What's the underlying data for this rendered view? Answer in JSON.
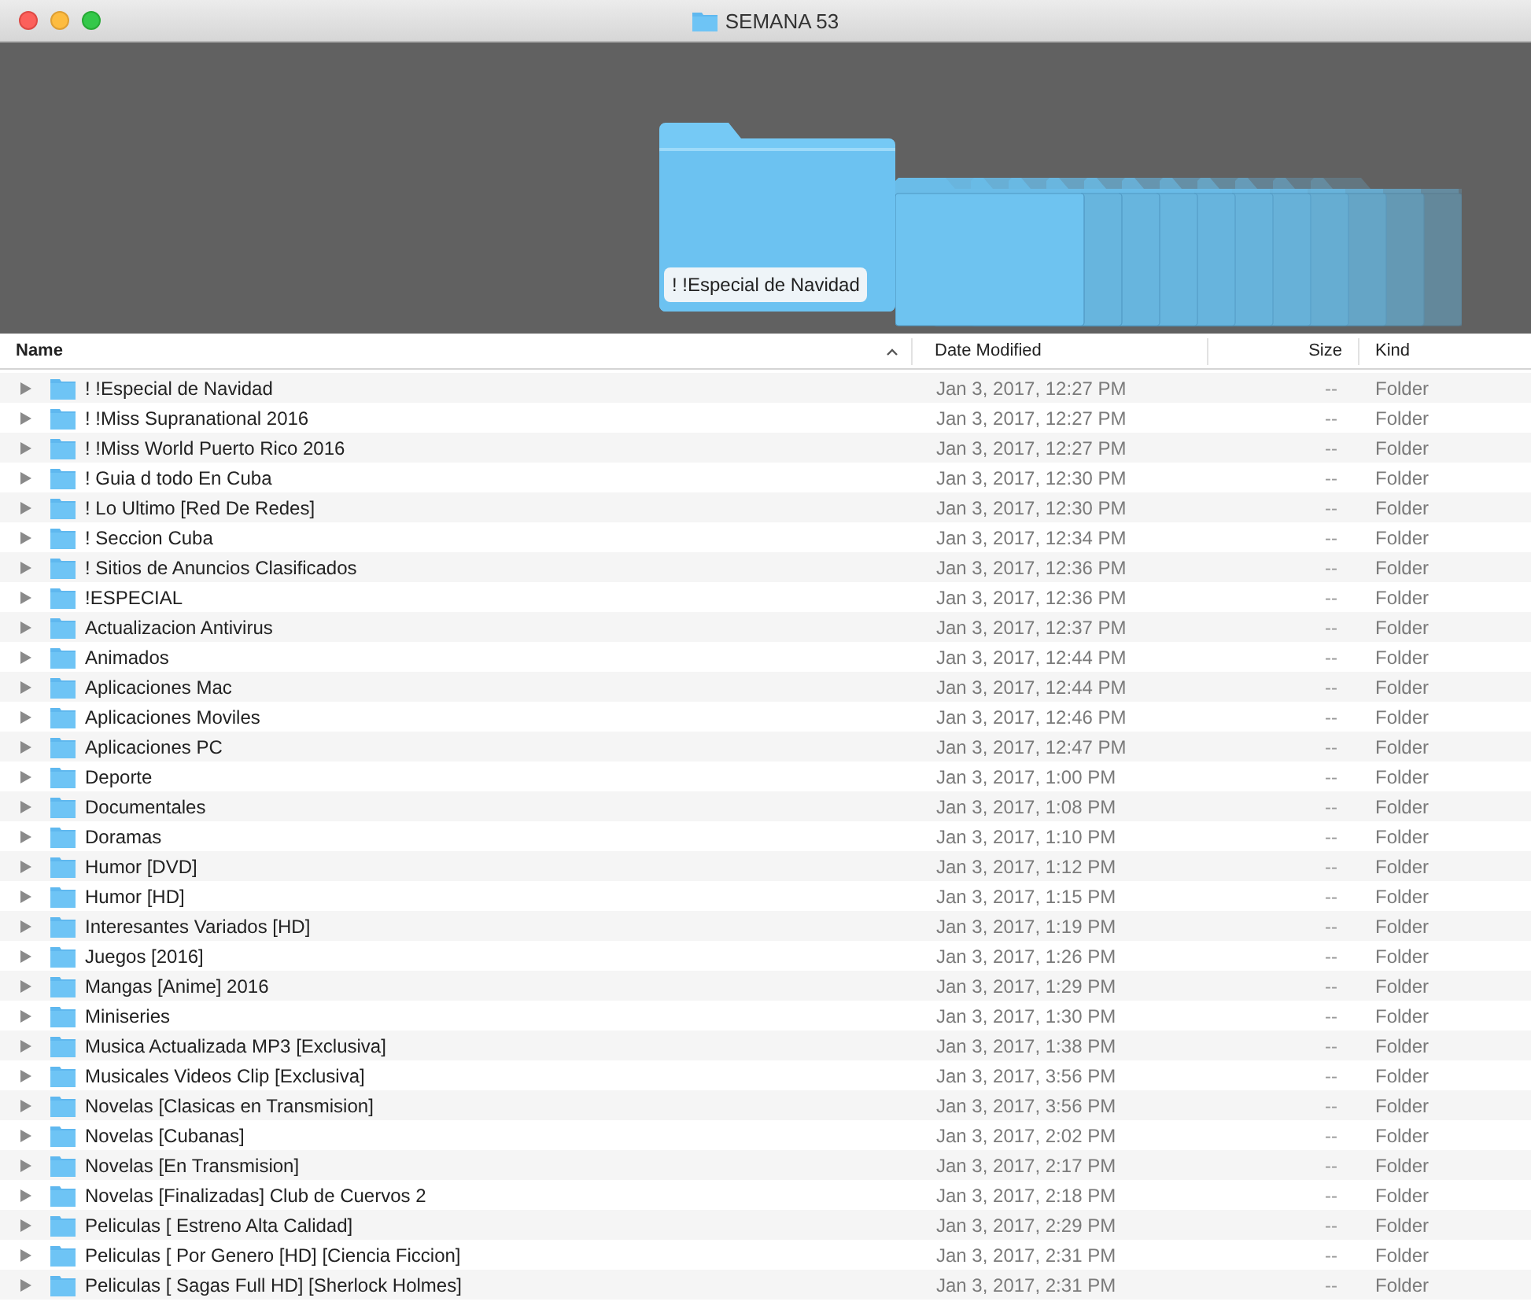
{
  "window": {
    "title": "SEMANA 53"
  },
  "preview": {
    "label": "! !Especial de Navidad"
  },
  "columns": [
    {
      "label": "Name",
      "sorted": true
    },
    {
      "label": "Date Modified",
      "sorted": false
    },
    {
      "label": "Size",
      "sorted": false
    },
    {
      "label": "Kind",
      "sorted": false
    }
  ],
  "rows": [
    {
      "name": "! !Especial de Navidad",
      "date": "Jan 3, 2017, 12:27 PM",
      "size": "--",
      "kind": "Folder"
    },
    {
      "name": "! !Miss Supranational 2016",
      "date": "Jan 3, 2017, 12:27 PM",
      "size": "--",
      "kind": "Folder"
    },
    {
      "name": "! !Miss World Puerto Rico 2016",
      "date": "Jan 3, 2017, 12:27 PM",
      "size": "--",
      "kind": "Folder"
    },
    {
      "name": "! Guia d todo En Cuba",
      "date": "Jan 3, 2017, 12:30 PM",
      "size": "--",
      "kind": "Folder"
    },
    {
      "name": "! Lo Ultimo [Red De Redes]",
      "date": "Jan 3, 2017, 12:30 PM",
      "size": "--",
      "kind": "Folder"
    },
    {
      "name": "! Seccion Cuba",
      "date": "Jan 3, 2017, 12:34 PM",
      "size": "--",
      "kind": "Folder"
    },
    {
      "name": "! Sitios de Anuncios Clasificados",
      "date": "Jan 3, 2017, 12:36 PM",
      "size": "--",
      "kind": "Folder"
    },
    {
      "name": "!ESPECIAL",
      "date": "Jan 3, 2017, 12:36 PM",
      "size": "--",
      "kind": "Folder"
    },
    {
      "name": "Actualizacion Antivirus",
      "date": "Jan 3, 2017, 12:37 PM",
      "size": "--",
      "kind": "Folder"
    },
    {
      "name": "Animados",
      "date": "Jan 3, 2017, 12:44 PM",
      "size": "--",
      "kind": "Folder"
    },
    {
      "name": "Aplicaciones Mac",
      "date": "Jan 3, 2017, 12:44 PM",
      "size": "--",
      "kind": "Folder"
    },
    {
      "name": "Aplicaciones Moviles",
      "date": "Jan 3, 2017, 12:46 PM",
      "size": "--",
      "kind": "Folder"
    },
    {
      "name": "Aplicaciones PC",
      "date": "Jan 3, 2017, 12:47 PM",
      "size": "--",
      "kind": "Folder"
    },
    {
      "name": "Deporte",
      "date": "Jan 3, 2017, 1:00 PM",
      "size": "--",
      "kind": "Folder"
    },
    {
      "name": "Documentales",
      "date": "Jan 3, 2017, 1:08 PM",
      "size": "--",
      "kind": "Folder"
    },
    {
      "name": "Doramas",
      "date": "Jan 3, 2017, 1:10 PM",
      "size": "--",
      "kind": "Folder"
    },
    {
      "name": "Humor [DVD]",
      "date": "Jan 3, 2017, 1:12 PM",
      "size": "--",
      "kind": "Folder"
    },
    {
      "name": "Humor [HD]",
      "date": "Jan 3, 2017, 1:15 PM",
      "size": "--",
      "kind": "Folder"
    },
    {
      "name": "Interesantes Variados [HD]",
      "date": "Jan 3, 2017, 1:19 PM",
      "size": "--",
      "kind": "Folder"
    },
    {
      "name": "Juegos [2016]",
      "date": "Jan 3, 2017, 1:26 PM",
      "size": "--",
      "kind": "Folder"
    },
    {
      "name": "Mangas [Anime] 2016",
      "date": "Jan 3, 2017, 1:29 PM",
      "size": "--",
      "kind": "Folder"
    },
    {
      "name": "Miniseries",
      "date": "Jan 3, 2017, 1:30 PM",
      "size": "--",
      "kind": "Folder"
    },
    {
      "name": "Musica Actualizada MP3 [Exclusiva]",
      "date": "Jan 3, 2017, 1:38 PM",
      "size": "--",
      "kind": "Folder"
    },
    {
      "name": "Musicales Videos Clip [Exclusiva]",
      "date": "Jan 3, 2017, 3:56 PM",
      "size": "--",
      "kind": "Folder"
    },
    {
      "name": "Novelas [Clasicas en Transmision]",
      "date": "Jan 3, 2017, 3:56 PM",
      "size": "--",
      "kind": "Folder"
    },
    {
      "name": "Novelas [Cubanas]",
      "date": "Jan 3, 2017, 2:02 PM",
      "size": "--",
      "kind": "Folder"
    },
    {
      "name": "Novelas [En Transmision]",
      "date": "Jan 3, 2017, 2:17 PM",
      "size": "--",
      "kind": "Folder"
    },
    {
      "name": "Novelas [Finalizadas] Club de Cuervos 2",
      "date": "Jan 3, 2017, 2:18 PM",
      "size": "--",
      "kind": "Folder"
    },
    {
      "name": "Peliculas [ Estreno Alta Calidad]",
      "date": "Jan 3, 2017, 2:29 PM",
      "size": "--",
      "kind": "Folder"
    },
    {
      "name": "Peliculas [ Por Genero [HD] [Ciencia Ficcion]",
      "date": "Jan 3, 2017, 2:31 PM",
      "size": "--",
      "kind": "Folder"
    },
    {
      "name": "Peliculas [ Sagas Full HD] [Sherlock Holmes]",
      "date": "Jan 3, 2017, 2:31 PM",
      "size": "--",
      "kind": "Folder"
    }
  ]
}
